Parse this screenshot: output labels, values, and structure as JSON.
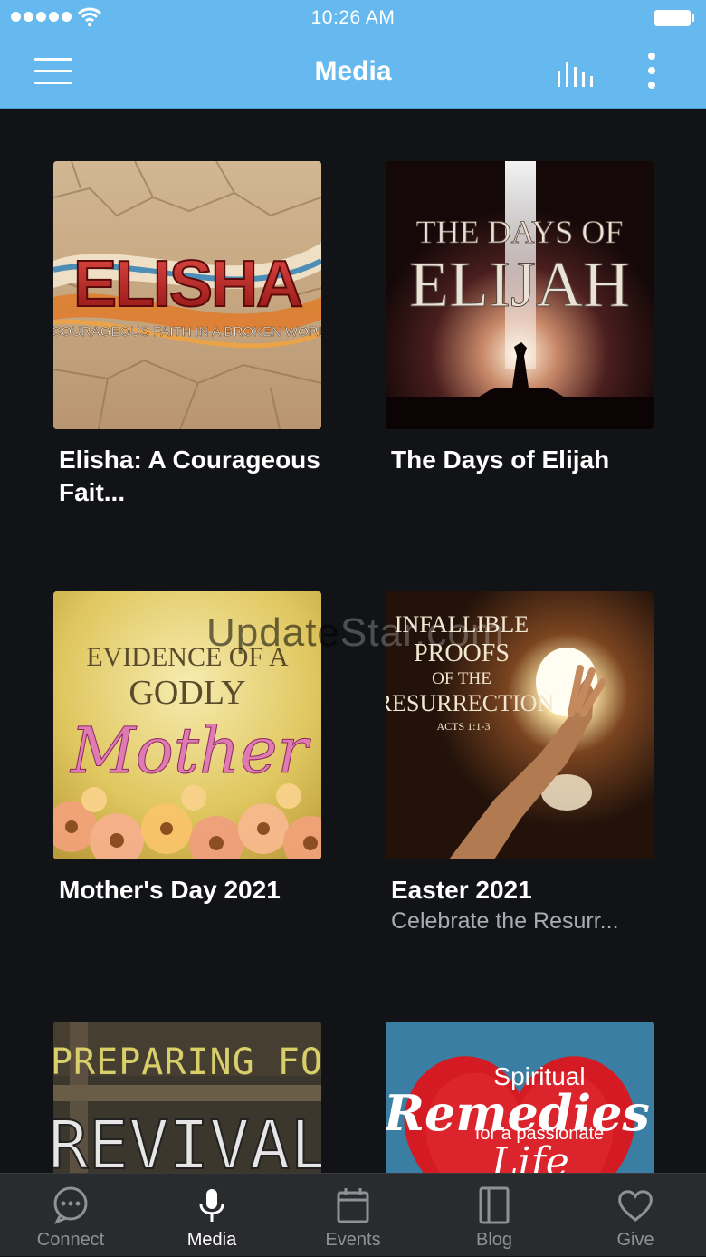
{
  "status_bar": {
    "time": "10:26 AM"
  },
  "header": {
    "title": "Media"
  },
  "media_items": [
    {
      "title": "Elisha: A Courageous Fait...",
      "subtitle": "",
      "art": {
        "top_text": "ELISHA",
        "bottom_text": "A COURAGEOUS FAITH IN A BROKEN WORLD"
      }
    },
    {
      "title": "The Days of Elijah",
      "subtitle": "",
      "art": {
        "top_text": "THE DAYS OF",
        "bottom_text": "ELIJAH"
      }
    },
    {
      "title": "Mother's Day 2021",
      "subtitle": "",
      "art": {
        "line1": "EVIDENCE OF A",
        "line2": "GODLY",
        "line3": "Mother"
      }
    },
    {
      "title": "Easter 2021",
      "subtitle": "Celebrate the Resurr...",
      "art": {
        "line1": "INFALLIBLE",
        "line2": "PROOFS",
        "line3": "OF THE",
        "line4": "RESURRECTION",
        "line5": "ACTS 1:1-3"
      }
    },
    {
      "title": "",
      "subtitle": "",
      "art": {
        "line1": "PREPARING FOR",
        "line2": "REVIVAL"
      }
    },
    {
      "title": "",
      "subtitle": "",
      "art": {
        "line1": "Spiritual",
        "line2": "Remedies",
        "line3": "for a passionate",
        "line4": "Life"
      }
    }
  ],
  "watermark": {
    "part1": "Update",
    "part2": "Star.com"
  },
  "tabs": [
    {
      "label": "Connect",
      "icon": "chat-bubble-icon"
    },
    {
      "label": "Media",
      "icon": "microphone-icon",
      "active": true
    },
    {
      "label": "Events",
      "icon": "calendar-icon"
    },
    {
      "label": "Blog",
      "icon": "book-icon"
    },
    {
      "label": "Give",
      "icon": "heart-icon"
    }
  ],
  "colors": {
    "accent": "#66b9ef",
    "background": "#121316",
    "tab_bar": "#2a2b2e",
    "inactive_tab": "#8e9196"
  }
}
